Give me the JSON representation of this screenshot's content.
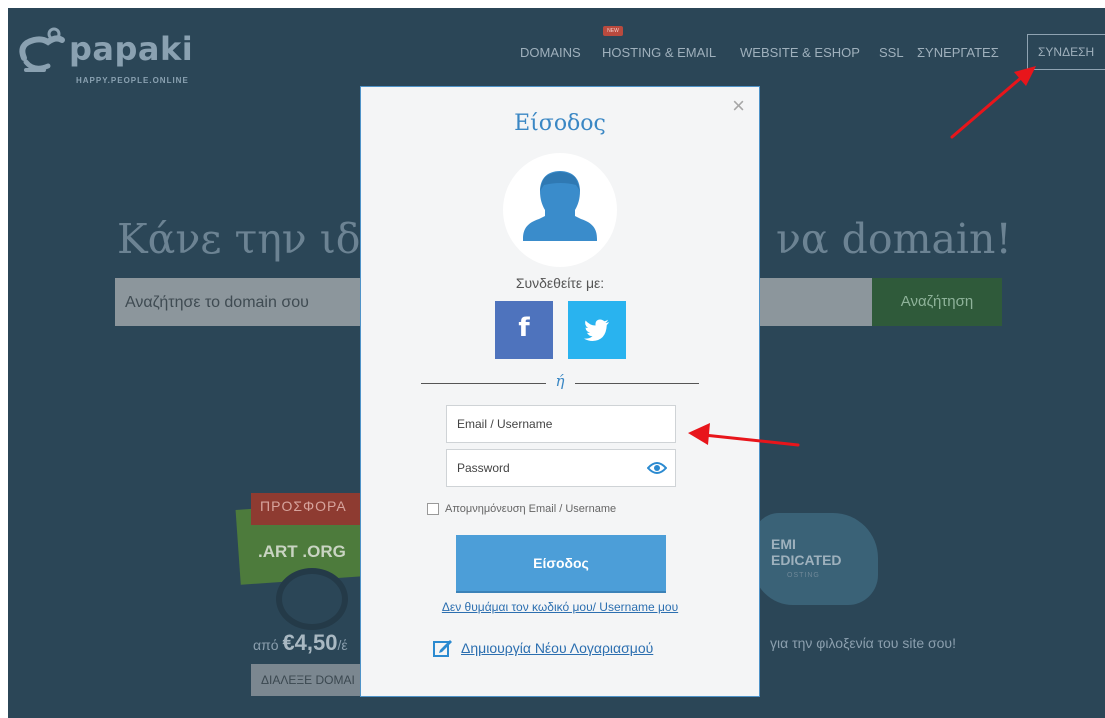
{
  "header": {
    "logo_name": "papaki",
    "logo_tagline": "HAPPY.PEOPLE.ONLINE",
    "nav_new_badge": "NEW",
    "nav": [
      "DOMAINS",
      "HOSTING & EMAIL",
      "WEBSITE & ESHOP",
      "SSL",
      "ΣΥΝΕΡΓΑΤΕΣ"
    ],
    "login_label": "ΣΥΝΔΕΣΗ"
  },
  "hero": {
    "left_text": "Κάνε την ιδ",
    "right_text": "να domain!",
    "search_placeholder": "Αναζήτησε το domain σου",
    "search_button": "Αναζήτηση"
  },
  "promo": {
    "badge": "ΠΡΟΣΦΟΡΑ",
    "tlds": ".ART .ORG",
    "price_prefix": "από",
    "price": "€4,50",
    "price_suffix": "/έ",
    "choose_button": "ΔΙΑΛΕΞΕ DOMAI"
  },
  "hosting_promo": {
    "title_line1": "EMI",
    "title_line2": "EDICATED",
    "subtitle": "OSTING",
    "caption": "για την φιλοξενία του site σου!"
  },
  "modal": {
    "title": "Είσοδος",
    "close_glyph": "×",
    "connect_with": "Συνδεθείτε με:",
    "facebook_glyph": "f",
    "or_text": "ή",
    "email_placeholder": "Email / Username",
    "password_placeholder": "Password",
    "remember_label": "Απομνημόνευση Email / Username",
    "submit_label": "Είσοδος",
    "forgot_link": "Δεν θυμάμαι τον κωδικό μου/ Username μου",
    "register_link": "Δημιουργία Νέου Λογαριασμού"
  },
  "icons": {
    "avatar": "user-silhouette-icon",
    "facebook": "facebook-icon",
    "twitter": "twitter-icon",
    "eye": "eye-icon",
    "register": "edit-icon"
  },
  "colors": {
    "page_bg": "#2b4657",
    "modal_accent": "#3a87c4",
    "submit_bg": "#4c9ed8",
    "facebook": "#4e73bd",
    "twitter": "#29b3ef",
    "annotation_arrow": "#e8151b"
  }
}
